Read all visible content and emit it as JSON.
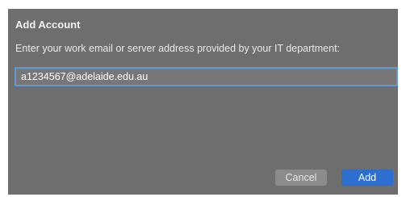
{
  "dialog": {
    "title": "Add Account",
    "subtitle": "Enter your work email or server address provided by your IT department:",
    "email_value": "a1234567@adelaide.edu.au",
    "cancel_label": "Cancel",
    "add_label": "Add"
  },
  "colors": {
    "dialog_background": "#6e6e6e",
    "field_focus_border": "#5f9ad6",
    "primary_button": "#2d6fd1",
    "secondary_button": "#8b8b8b"
  }
}
